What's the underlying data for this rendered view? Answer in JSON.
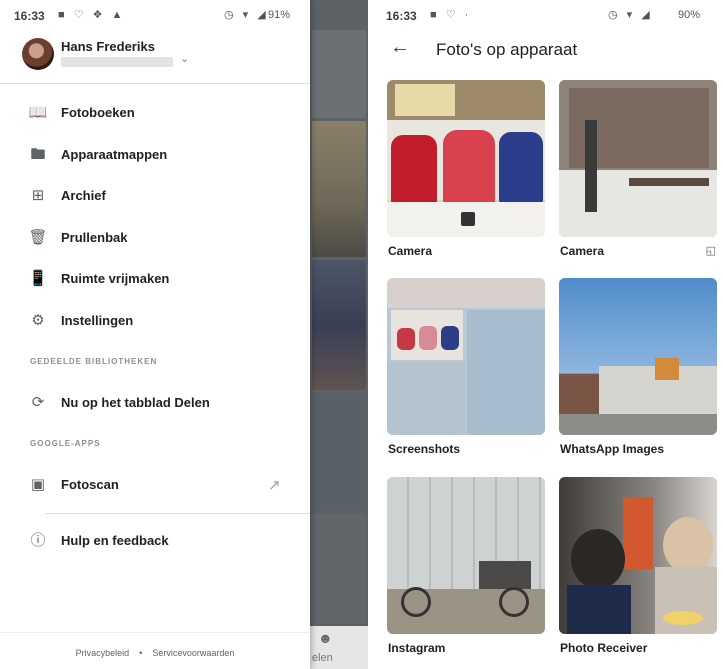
{
  "left_screen": {
    "status_bar": {
      "time": "16:33",
      "left_icons": [
        "notification-icon",
        "heart-icon",
        "cast-icon",
        "photo-icon"
      ],
      "right_icons": [
        "alarm-icon",
        "wifi-icon",
        "signal-icon"
      ],
      "battery": "91%"
    },
    "account": {
      "name": "Hans Frederiks",
      "email_redacted": true
    },
    "menu": [
      {
        "label": "Fotoboeken",
        "icon": "photobook-icon"
      },
      {
        "label": "Apparaatmappen",
        "icon": "folder-icon"
      },
      {
        "label": "Archief",
        "icon": "archive-icon"
      },
      {
        "label": "Prullenbak",
        "icon": "trash-icon"
      },
      {
        "label": "Ruimte vrijmaken",
        "icon": "free-space-icon"
      },
      {
        "label": "Instellingen",
        "icon": "settings-icon"
      }
    ],
    "sections": {
      "shared_libraries": "GEDEELDE BIBLIOTHEKEN",
      "google_apps": "GOOGLE-APPS"
    },
    "shared_item": {
      "label": "Nu op het tabblad Delen",
      "icon": "sharing-icon"
    },
    "google_app_item": {
      "label": "Fotoscan",
      "icon": "photoscan-icon",
      "trailing_icon": "open-external-icon"
    },
    "help_item": {
      "label": "Hulp en feedback",
      "icon": "help-icon"
    },
    "footer": {
      "privacy": "Privacybeleid",
      "separator": "•",
      "terms": "Servicevoorwaarden"
    },
    "background_nav": {
      "partial_label": "elen"
    }
  },
  "right_screen": {
    "status_bar": {
      "time": "16:33",
      "left_icons": [
        "notification-icon",
        "heart-icon",
        "dot-icon"
      ],
      "right_icons": [
        "alarm-icon",
        "wifi-icon",
        "4g-icon",
        "signal-icon"
      ],
      "battery": "90%"
    },
    "title": "Foto's op apparaat",
    "folders": [
      {
        "label": "Camera",
        "badge_icon": ""
      },
      {
        "label": "Camera",
        "badge_icon": "sd-card-icon"
      },
      {
        "label": "Screenshots",
        "badge_icon": ""
      },
      {
        "label": "WhatsApp Images",
        "badge_icon": ""
      },
      {
        "label": "Instagram",
        "badge_icon": ""
      },
      {
        "label": "Photo Receiver",
        "badge_icon": ""
      }
    ]
  },
  "colors": {
    "drawer_bg": "#ffffff",
    "scrim": "#5d6266",
    "text_primary": "#202124",
    "icon_grey": "#5f6368",
    "section_grey": "#8a8f94"
  }
}
